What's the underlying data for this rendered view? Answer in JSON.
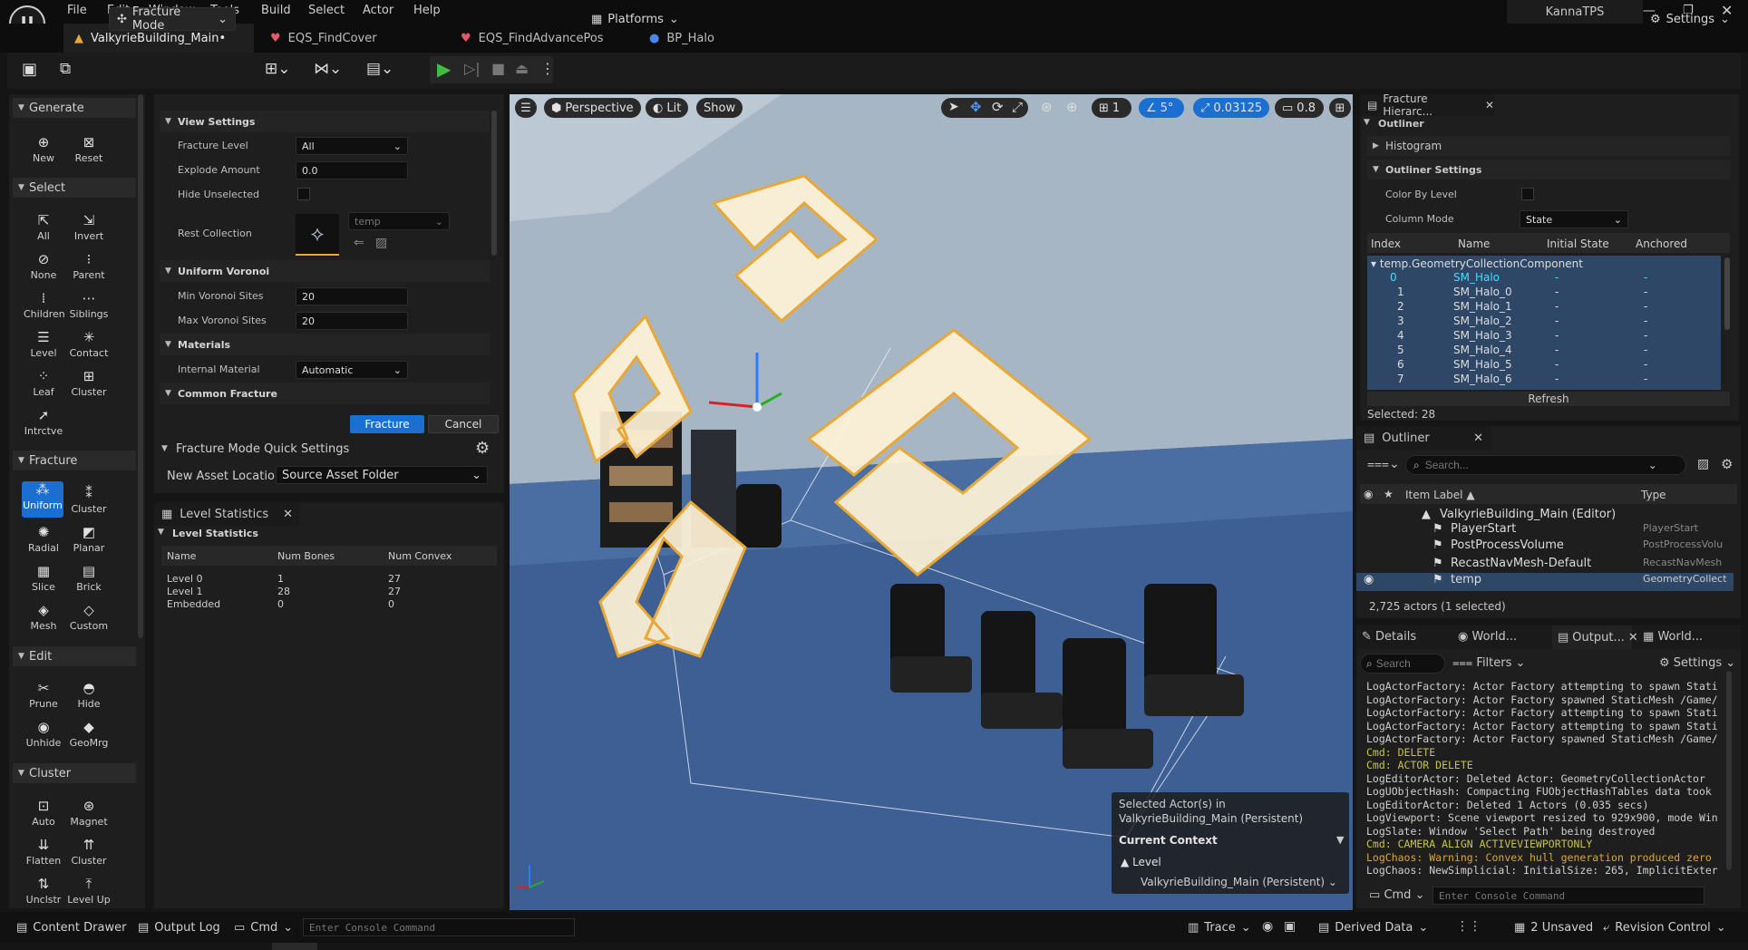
{
  "app": {
    "logo": "U",
    "user": "KannaTPS"
  },
  "menu": [
    "File",
    "Edit",
    "Window",
    "Tools",
    "Build",
    "Select",
    "Actor",
    "Help"
  ],
  "tabs": [
    {
      "label": "ValkyrieBuilding_Main•",
      "icon": "level-icon"
    },
    {
      "label": "EQS_FindCover",
      "icon": "eqs-icon"
    },
    {
      "label": "EQS_FindAdvancePos",
      "icon": "eqs-icon"
    },
    {
      "label": "BP_Halo",
      "icon": "blueprint-icon"
    }
  ],
  "toolbar": {
    "mode": "Fracture Mode",
    "platforms": "Platforms",
    "settings": "Settings"
  },
  "tool_palette": {
    "groups": [
      {
        "name": "Generate",
        "tools": [
          "New",
          "Reset"
        ]
      },
      {
        "name": "Select",
        "tools": [
          "All",
          "Invert",
          "None",
          "Parent",
          "Children",
          "Siblings",
          "Level",
          "Contact",
          "Leaf",
          "Cluster",
          "Intrctve"
        ]
      },
      {
        "name": "Fracture",
        "tools": [
          "Uniform",
          "Cluster",
          "Radial",
          "Planar",
          "Slice",
          "Brick",
          "Mesh",
          "Custom"
        ]
      },
      {
        "name": "Edit",
        "tools": [
          "Prune",
          "Hide",
          "Unhide",
          "GeoMrg"
        ]
      },
      {
        "name": "Cluster",
        "tools": [
          "Auto",
          "Magnet",
          "Flatten",
          "Cluster",
          "Unclstr",
          "Level Up"
        ]
      }
    ]
  },
  "settings_panel": {
    "view_settings": "View Settings",
    "fracture_level_label": "Fracture Level",
    "fracture_level": "All",
    "explode_label": "Explode Amount",
    "explode": "0.0",
    "hide_unselected_label": "Hide Unselected",
    "rest_collection_label": "Rest Collection",
    "rest_collection": "temp",
    "uniform_voronoi": "Uniform Voronoi",
    "min_sites_label": "Min Voronoi Sites",
    "min_sites": "20",
    "max_sites_label": "Max Voronoi Sites",
    "max_sites": "20",
    "materials": "Materials",
    "internal_material_label": "Internal Material",
    "internal_material": "Automatic",
    "common_fracture": "Common Fracture",
    "fracture_btn": "Fracture",
    "cancel_btn": "Cancel",
    "quick_settings": "Fracture Mode Quick Settings",
    "new_asset_label": "New Asset Location",
    "new_asset": "Source Asset Folder"
  },
  "level_stats": {
    "tab": "Level Statistics",
    "section": "Level Statistics",
    "headers": [
      "Name",
      "Num Bones",
      "Num Convex"
    ],
    "rows": [
      [
        "Level 0",
        "1",
        "27"
      ],
      [
        "Level 1",
        "28",
        "27"
      ],
      [
        "Embedded",
        "0",
        "0"
      ]
    ]
  },
  "viewport": {
    "perspective": "Perspective",
    "lit": "Lit",
    "show": "Show",
    "grid": "1",
    "angle": "5°",
    "scale": "0.03125",
    "camera": "0.8",
    "selected_info": "Selected Actor(s) in",
    "selected_level": "ValkyrieBuilding_Main (Persistent)",
    "current_context": "Current Context",
    "level_label": "Level",
    "level_value": "ValkyrieBuilding_Main (Persistent)"
  },
  "fracture_hierarchy": {
    "tab": "Fracture Hierarc...",
    "outliner": "Outliner",
    "histogram": "Histogram",
    "outliner_settings": "Outliner Settings",
    "color_by_level": "Color By Level",
    "column_mode_label": "Column Mode",
    "column_mode": "State",
    "headers": [
      "Index",
      "Name",
      "Initial State",
      "Anchored"
    ],
    "component": "temp.GeometryCollectionComponent",
    "rows": [
      {
        "idx": "0",
        "name": "SM_Halo",
        "st": "-",
        "an": "-"
      },
      {
        "idx": "1",
        "name": "SM_Halo_0",
        "st": "-",
        "an": "-"
      },
      {
        "idx": "2",
        "name": "SM_Halo_1",
        "st": "-",
        "an": "-"
      },
      {
        "idx": "3",
        "name": "SM_Halo_2",
        "st": "-",
        "an": "-"
      },
      {
        "idx": "4",
        "name": "SM_Halo_3",
        "st": "-",
        "an": "-"
      },
      {
        "idx": "5",
        "name": "SM_Halo_4",
        "st": "-",
        "an": "-"
      },
      {
        "idx": "6",
        "name": "SM_Halo_5",
        "st": "-",
        "an": "-"
      },
      {
        "idx": "7",
        "name": "SM_Halo_6",
        "st": "-",
        "an": "-"
      }
    ],
    "refresh": "Refresh",
    "selected": "Selected: 28"
  },
  "outliner": {
    "tab": "Outliner",
    "search_placeholder": "Search...",
    "col_label": "Item Label ▲",
    "col_type": "Type",
    "world": "ValkyrieBuilding_Main (Editor)",
    "items": [
      {
        "label": "PlayerStart",
        "type": "PlayerStart"
      },
      {
        "label": "PostProcessVolume",
        "type": "PostProcessVolu"
      },
      {
        "label": "RecastNavMesh-Default",
        "type": "RecastNavMesh"
      },
      {
        "label": "temp",
        "type": "GeometryCollect"
      }
    ],
    "count": "2,725 actors (1 selected)"
  },
  "bottom_tabs": [
    "Details",
    "World...",
    "Output...",
    "World..."
  ],
  "output": {
    "search_placeholder": "Search",
    "filters": "Filters",
    "settings": "Settings",
    "lines": [
      {
        "t": "LogActorFactory: Actor Factory attempting to spawn Stati",
        "c": "#cfcfcf"
      },
      {
        "t": "LogActorFactory: Actor Factory spawned StaticMesh /Game/",
        "c": "#cfcfcf"
      },
      {
        "t": "LogActorFactory: Actor Factory attempting to spawn Stati",
        "c": "#cfcfcf"
      },
      {
        "t": "LogActorFactory: Actor Factory attempting to spawn Stati",
        "c": "#cfcfcf"
      },
      {
        "t": "LogActorFactory: Actor Factory spawned StaticMesh /Game/",
        "c": "#cfcfcf"
      },
      {
        "t": "Cmd: DELETE",
        "c": "#c8c24a"
      },
      {
        "t": "Cmd: ACTOR DELETE",
        "c": "#c8c24a"
      },
      {
        "t": "LogEditorActor: Deleted Actor: GeometryCollectionActor",
        "c": "#cfcfcf"
      },
      {
        "t": "LogUObjectHash: Compacting FUObjectHashTables data took",
        "c": "#cfcfcf"
      },
      {
        "t": "LogEditorActor: Deleted 1 Actors (0.035 secs)",
        "c": "#cfcfcf"
      },
      {
        "t": "LogViewport: Scene viewport resized to 929x900, mode Win",
        "c": "#cfcfcf"
      },
      {
        "t": "LogSlate: Window 'Select Path' being destroyed",
        "c": "#cfcfcf"
      },
      {
        "t": "Cmd: CAMERA ALIGN ACTIVEVIEWPORTONLY",
        "c": "#c8c24a"
      },
      {
        "t": "LogChaos: Warning: Convex hull generation produced zero",
        "c": "#d8a83a"
      },
      {
        "t": "LogChaos: NewSimplicial: InitialSize: 265, ImplicitExter",
        "c": "#cfcfcf"
      }
    ],
    "cmd": "Cmd",
    "console_placeholder": "Enter Console Command"
  },
  "statusbar": {
    "content_drawer": "Content Drawer",
    "output_log": "Output Log",
    "cmd": "Cmd",
    "console_placeholder": "Enter Console Command",
    "trace": "Trace",
    "derived_data": "Derived Data",
    "unsaved": "2 Unsaved",
    "revision": "Revision Control"
  },
  "colors": {
    "accent": "#1a6fd0",
    "halo_outline": "#e8a838",
    "floor": "#3d5f93",
    "selection": "#2e4766"
  }
}
